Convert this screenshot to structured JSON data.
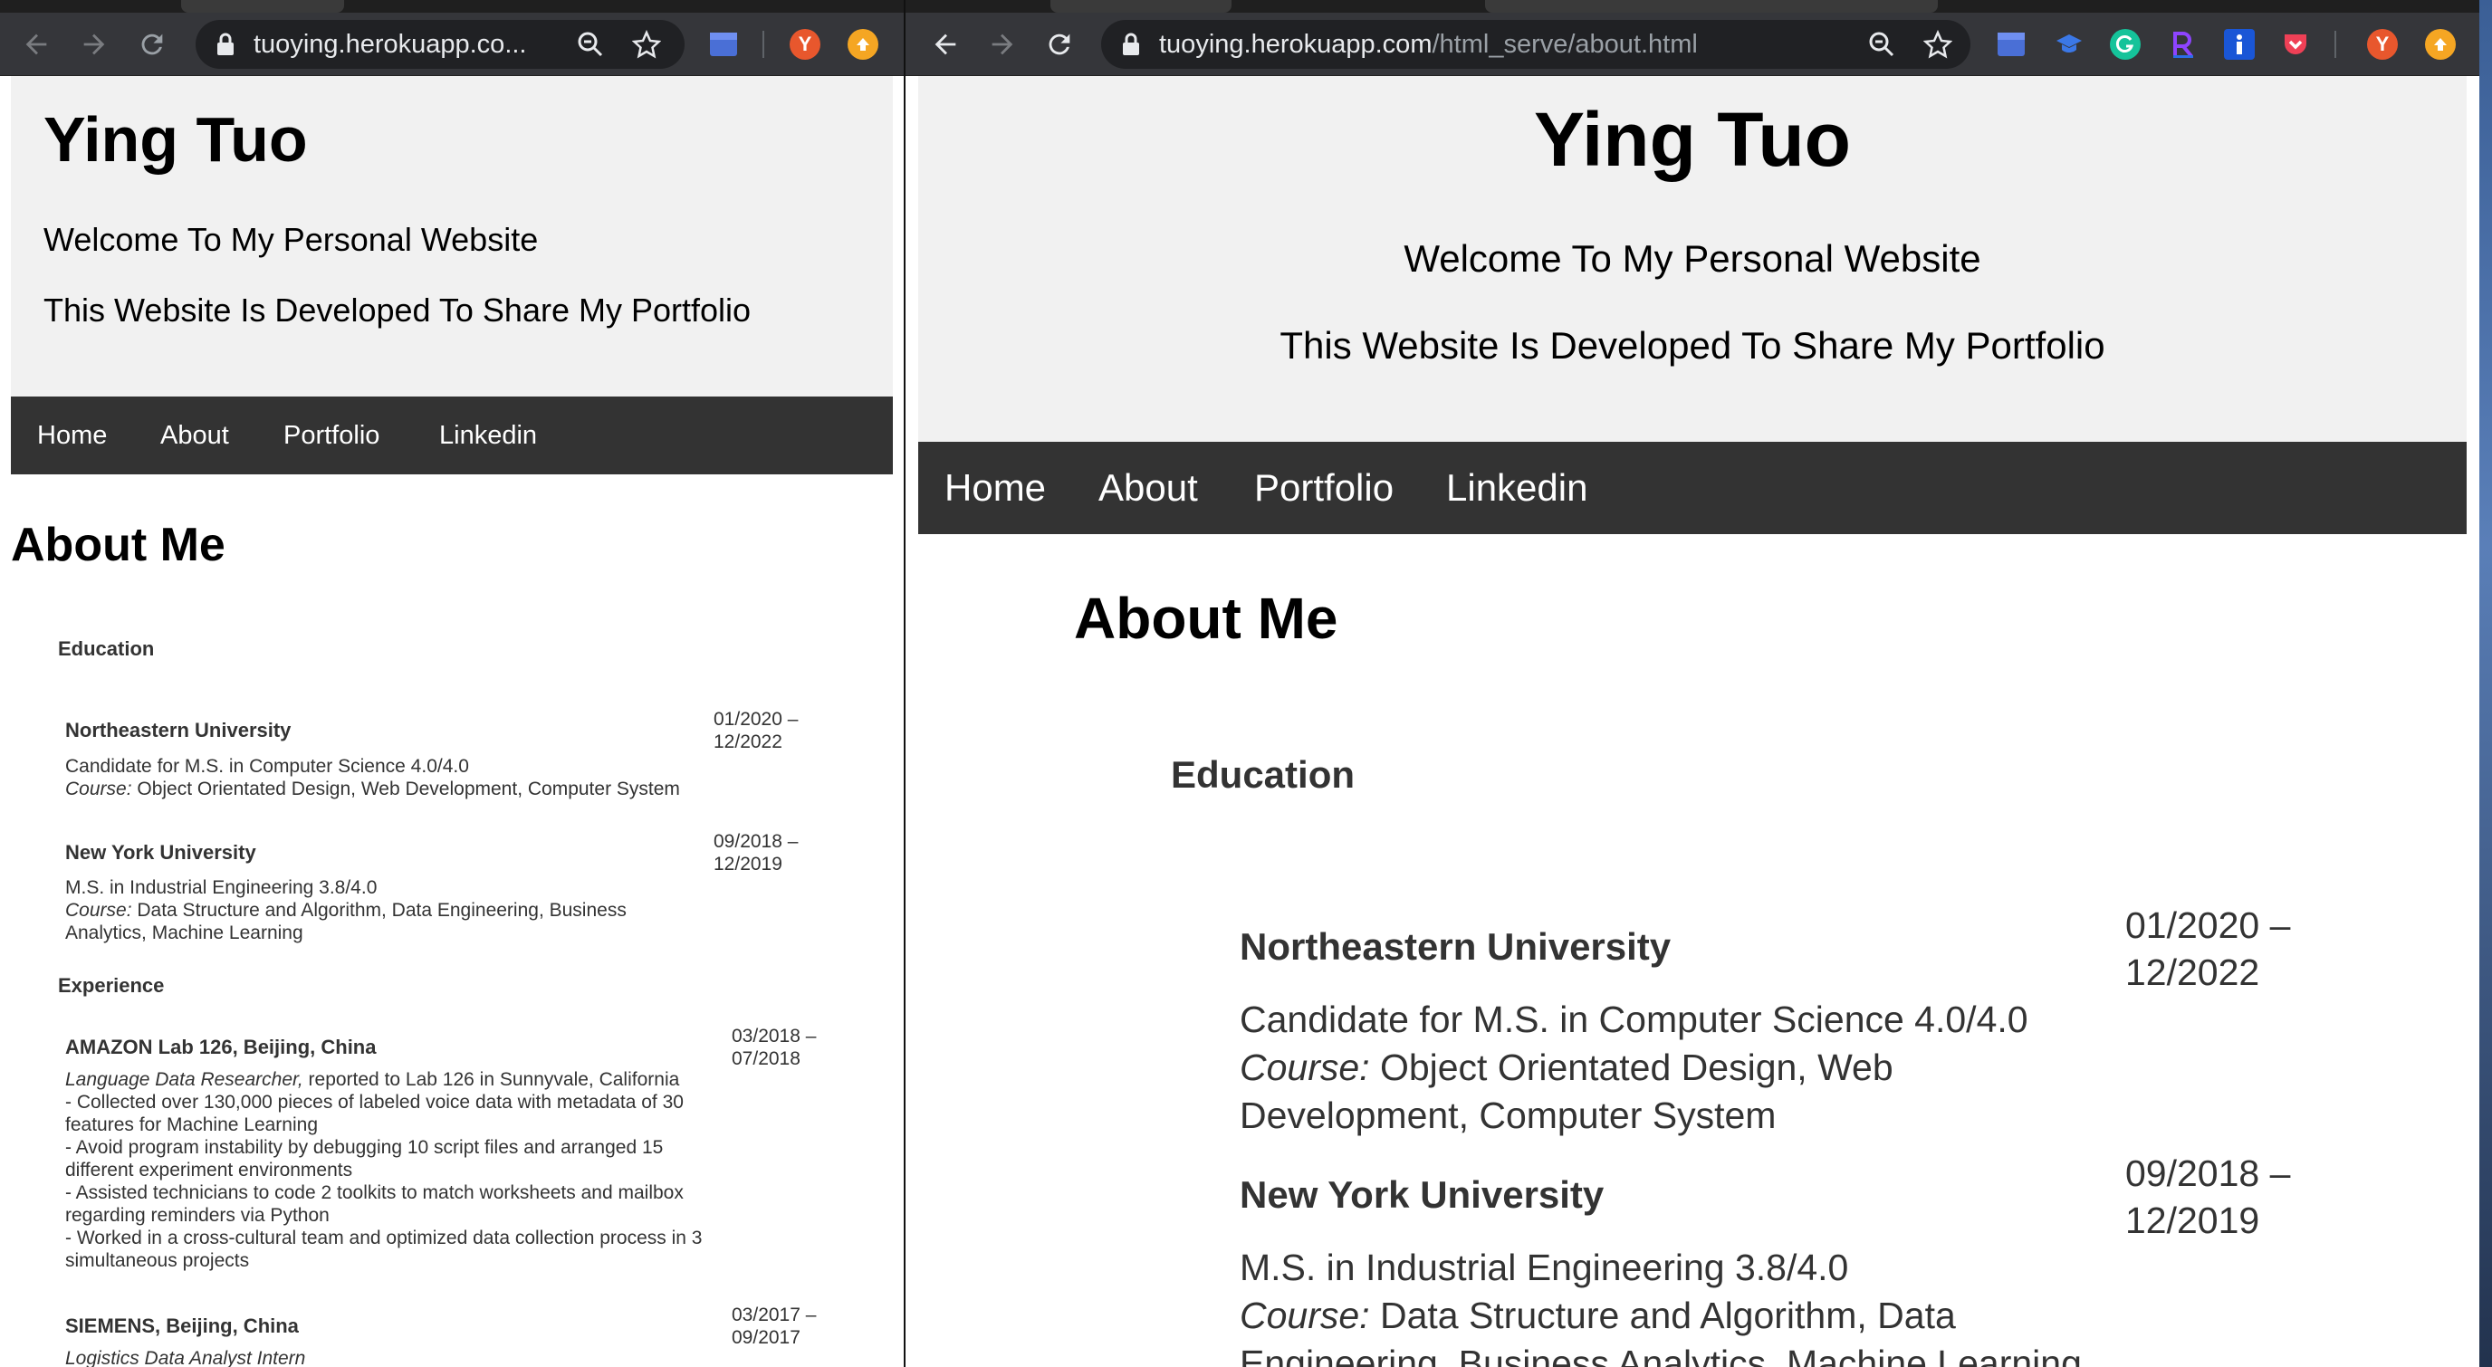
{
  "browser_left": {
    "url_display": "tuoying.herokuapp.co...",
    "avatar_initial": "Y"
  },
  "browser_right": {
    "url_domain": "tuoying.herokuapp.com",
    "url_path": "/html_serve/about.html",
    "avatar_initial": "Y"
  },
  "site": {
    "title": "Ying Tuo",
    "subtitle_1": "Welcome To My Personal Website",
    "subtitle_2": "This Website Is Developed To Share My Portfolio",
    "nav": [
      "Home",
      "About",
      "Portfolio",
      "Linkedin"
    ],
    "page_heading": "About Me"
  },
  "education": {
    "heading": "Education",
    "entries": [
      {
        "org": "Northeastern University",
        "date_1": "01/2020 –",
        "date_2": "12/2022",
        "degree": "Candidate for M.S. in Computer Science 4.0/4.0",
        "course_label": "Course:",
        "course_text": " Object Orientated Design, Web Development, Computer System"
      },
      {
        "org": "New York University",
        "date_1": "09/2018 –",
        "date_2": "12/2019",
        "degree": "M.S. in Industrial Engineering 3.8/4.0",
        "course_label": "Course:",
        "course_text": " Data Structure and Algorithm, Data Engineering, Business Analytics, Machine Learning"
      }
    ]
  },
  "experience": {
    "heading": "Experience",
    "entries": [
      {
        "org": "AMAZON Lab 126, Beijing, China",
        "date_1": "03/2018 –",
        "date_2": "07/2018",
        "role": "Language Data Researcher,",
        "role_rest": " reported to Lab 126 in Sunnyvale, California",
        "bullets": [
          "- Collected over 130,000 pieces of labeled voice data with metadata of 30 features for Machine Learning",
          "- Avoid program instability by debugging 10 script files and arranged 15 different experiment environments",
          "- Assisted technicians to code 2 toolkits to match worksheets and mailbox regarding reminders via Python",
          "- Worked in a cross-cultural team and optimized data collection process in 3 simultaneous projects"
        ]
      },
      {
        "org": "SIEMENS, Beijing, China",
        "date_1": "03/2017 –",
        "date_2": "09/2017",
        "role": "Logistics Data Analyst Intern"
      }
    ]
  },
  "colors": {
    "chrome_toolbar": "#35363a",
    "omnibox": "#202124",
    "header_bg": "#f1f1f1",
    "nav_bg": "#333333"
  }
}
